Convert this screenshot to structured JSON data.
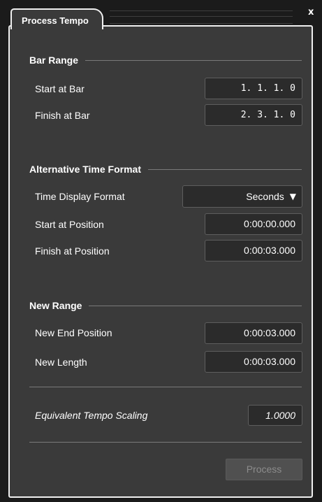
{
  "window": {
    "tab_title": "Process Tempo",
    "close_glyph": "x"
  },
  "bar_range": {
    "heading": "Bar Range",
    "start_label": "Start at Bar",
    "start_value": "1. 1. 1.  0",
    "finish_label": "Finish at Bar",
    "finish_value": "2. 3. 1.  0"
  },
  "alt_format": {
    "heading": "Alternative Time Format",
    "display_label": "Time Display Format",
    "display_value": "Seconds",
    "dropdown_glyph": "▼",
    "start_label": "Start at Position",
    "start_value": "0:00:00.000",
    "finish_label": "Finish at Position",
    "finish_value": "0:00:03.000"
  },
  "new_range": {
    "heading": "New Range",
    "end_label": "New End Position",
    "end_value": "0:00:03.000",
    "length_label": "New Length",
    "length_value": "0:00:03.000"
  },
  "scaling": {
    "label": "Equivalent Tempo Scaling",
    "value": "1.0000"
  },
  "footer": {
    "process_label": "Process",
    "process_enabled": false
  },
  "colors": {
    "panel": "#3a3a3a",
    "field": "#2b2b2b",
    "border": "#efefef",
    "button_disabled_text": "#8c8c8c"
  }
}
